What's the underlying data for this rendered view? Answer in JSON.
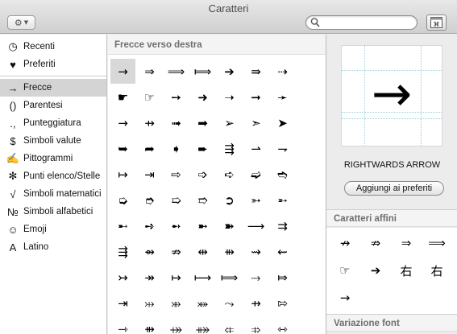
{
  "window": {
    "title": "Caratteri"
  },
  "toolbar": {
    "gear_icon": "gear-icon",
    "search_placeholder": "",
    "search_value": "",
    "palette_icon": "character-palette-icon"
  },
  "sidebar": {
    "items": [
      {
        "label": "Recenti",
        "icon": "◷",
        "icon_name": "clock-icon"
      },
      {
        "label": "Preferiti",
        "icon": "♥",
        "icon_name": "heart-icon"
      },
      {
        "label": "Frecce",
        "icon": "→",
        "icon_name": "arrow-icon",
        "selected": true
      },
      {
        "label": "Parentesi",
        "icon": "()",
        "icon_name": "parentheses-icon"
      },
      {
        "label": "Punteggiatura",
        "icon": ".,",
        "icon_name": "punctuation-icon"
      },
      {
        "label": "Simboli valute",
        "icon": "$",
        "icon_name": "currency-icon"
      },
      {
        "label": "Pittogrammi",
        "icon": "✍",
        "icon_name": "pictogram-icon"
      },
      {
        "label": "Punti elenco/Stelle",
        "icon": "✻",
        "icon_name": "asterisk-icon"
      },
      {
        "label": "Simboli matematici",
        "icon": "√",
        "icon_name": "square-root-icon"
      },
      {
        "label": "Simboli alfabetici",
        "icon": "№",
        "icon_name": "numero-icon"
      },
      {
        "label": "Emoji",
        "icon": "☺",
        "icon_name": "smiley-icon"
      },
      {
        "label": "Latino",
        "icon": "A",
        "icon_name": "latin-letter-icon"
      }
    ]
  },
  "grid": {
    "header": "Frecce verso destra",
    "rows": [
      [
        "→",
        "⇒",
        "⟹",
        "⟾",
        "➔",
        "⇛",
        "⇢"
      ],
      [
        "☛",
        "☞",
        "➙",
        "➜",
        "➝",
        "➞",
        "➛"
      ],
      [
        "→",
        "⇸",
        "➟",
        "➡",
        "➢",
        "➣",
        "➤"
      ],
      [
        "➥",
        "➦",
        "➧",
        "➨",
        "⇶",
        "⇀",
        "⇁"
      ],
      [
        "↦",
        "⇥",
        "⇨",
        "➩",
        "➪",
        "➫",
        "➬"
      ],
      [
        "➭",
        "➮",
        "➯",
        "➱",
        "➲",
        "➳",
        "➵"
      ],
      [
        "➸",
        "➺",
        "➻",
        "➼",
        "➽",
        "⟶",
        "⇉"
      ],
      [
        "⇶",
        "⇴",
        "⇏",
        "⇹",
        "⇻",
        "⇝",
        "⇜"
      ],
      [
        "↣",
        "↠",
        "↦",
        "⟼",
        "⟾",
        "⤑",
        "⤇"
      ],
      [
        "⇥",
        "⤔",
        "⤕",
        "⤘",
        "⤳",
        "⇸",
        "⇰"
      ],
      [
        "⇾",
        "⇻",
        "⤀",
        "⤁",
        "⤂",
        "⤃",
        "⇿"
      ]
    ]
  },
  "detail": {
    "glyph": "→",
    "name": "RIGHTWARDS ARROW",
    "add_favorite_label": "Aggiungi ai preferiti",
    "related_header": "Caratteri affini",
    "related": [
      "↛",
      "⇏",
      "⇒",
      "⟹",
      "☞",
      "➔",
      "右",
      "右",
      "→"
    ],
    "font_variation_header": "Variazione font"
  }
}
